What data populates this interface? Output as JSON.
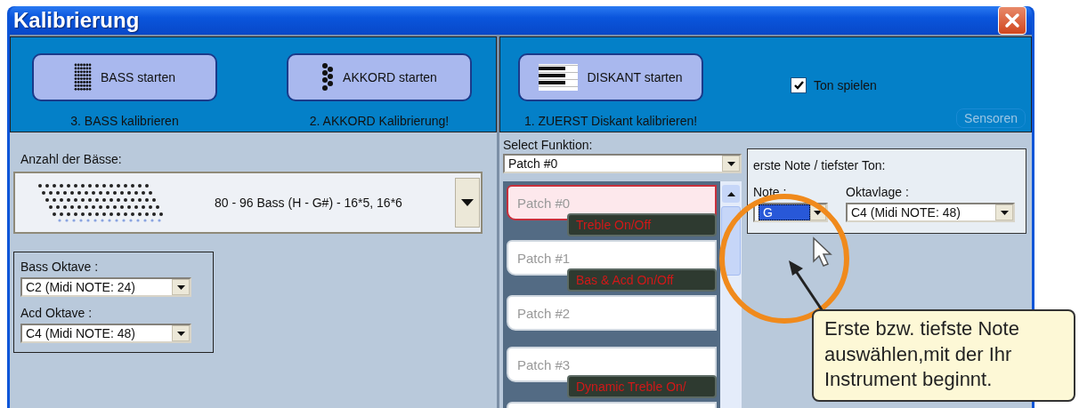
{
  "window": {
    "title": "Kalibrierung"
  },
  "calibration_buttons": [
    {
      "kind": "bass",
      "label": "BASS starten",
      "caption": "3. BASS kalibrieren"
    },
    {
      "kind": "chord",
      "label": "AKKORD starten",
      "caption": "2. AKKORD Kalibrierung!"
    },
    {
      "kind": "treble",
      "label": "DISKANT starten",
      "caption": "1. ZUERST Diskant kalibrieren!"
    }
  ],
  "play_tone": {
    "label": "Ton spielen",
    "checked": true
  },
  "sensors_button": {
    "label": "Sensoren",
    "disabled": true
  },
  "bass_count": {
    "label": "Anzahl der Bässe:",
    "value": "80 - 96 Bass (H - G#)  - 16*5, 16*6"
  },
  "octaves": [
    {
      "label": "Bass Oktave :",
      "value": "C2  (Midi NOTE: 24)"
    },
    {
      "label": "Acd Oktave :",
      "value": "C4  (Midi NOTE: 48)"
    }
  ],
  "function_select": {
    "label": "Select Funktion:",
    "value": "Patch #0"
  },
  "patches": [
    {
      "name": "Patch #0",
      "function": "Treble  On/Off",
      "selected": true
    },
    {
      "name": "Patch #1",
      "function": "Bas & Acd On/Off",
      "selected": false
    },
    {
      "name": "Patch #2",
      "selected": false
    },
    {
      "name": "Patch #3",
      "function": "Dynamic Treble On/",
      "selected": false
    }
  ],
  "first_note": {
    "title": "erste Note / tiefster Ton:",
    "note_label": "Note :",
    "note_value": "G",
    "octave_label": "Oktavlage :",
    "octave_value": "C4  (Midi NOTE: 48)"
  },
  "callout": {
    "text": "Erste bzw. tiefste Note auswählen,mit der Ihr Instrument beginnt."
  }
}
